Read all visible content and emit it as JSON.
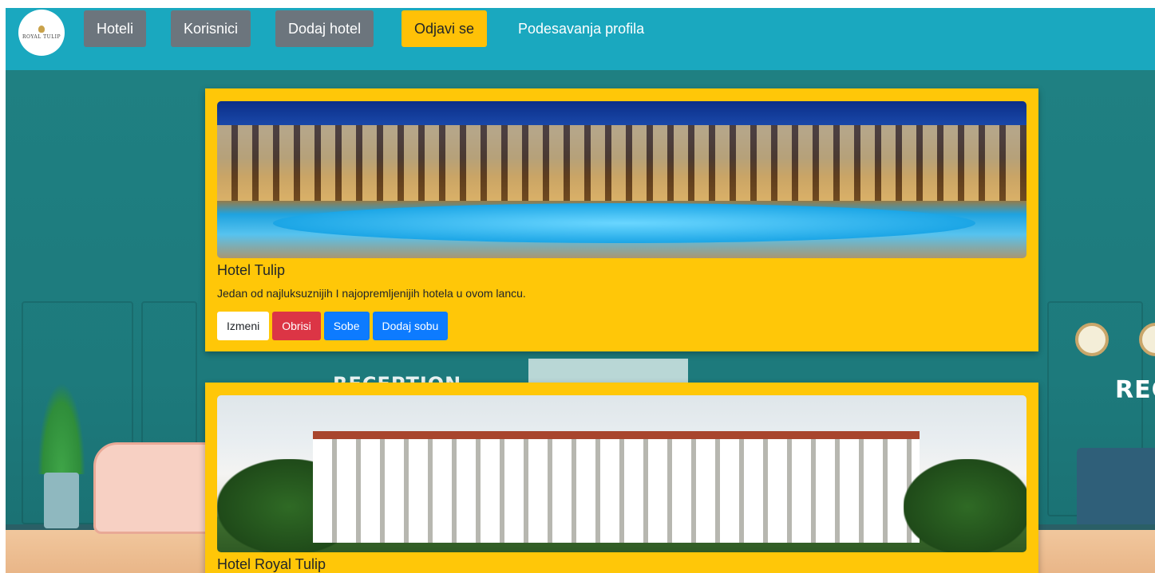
{
  "navbar": {
    "logo_text": "ROYAL TULIP",
    "items": [
      {
        "label": "Hoteli"
      },
      {
        "label": "Korisnici"
      },
      {
        "label": "Dodaj hotel"
      },
      {
        "label": "Odjavi se"
      },
      {
        "label": "Podesavanja profila"
      }
    ]
  },
  "background": {
    "reception_left": "RECEPTION",
    "reception_right": "REC"
  },
  "hotels": [
    {
      "name": "Hotel Tulip",
      "description": "Jedan od najluksuznijih I najopremljenijih hotela u ovom lancu.",
      "buttons": {
        "edit": "Izmeni",
        "delete": "Obrisi",
        "rooms": "Sobe",
        "add_room": "Dodaj sobu"
      }
    },
    {
      "name": "Hotel Royal Tulip"
    }
  ],
  "colors": {
    "navbar": "#1aa8bf",
    "card": "#ffc708",
    "secondary_button": "#6c757d",
    "warning_button": "#ffc107",
    "danger_button": "#dc3545",
    "primary_button": "#0d7bff"
  }
}
